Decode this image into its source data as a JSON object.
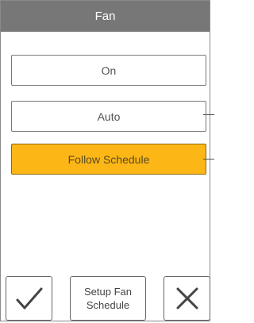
{
  "header": {
    "title": "Fan"
  },
  "options": [
    {
      "label": "On",
      "selected": false
    },
    {
      "label": "Auto",
      "selected": false
    },
    {
      "label": "Follow Schedule",
      "selected": true
    }
  ],
  "footer": {
    "confirm_icon": "checkmark-icon",
    "setup_label_line1": "Setup Fan",
    "setup_label_line2": "Schedule",
    "cancel_icon": "x-icon"
  },
  "colors": {
    "titlebar": "#777777",
    "selected": "#fcb716"
  }
}
